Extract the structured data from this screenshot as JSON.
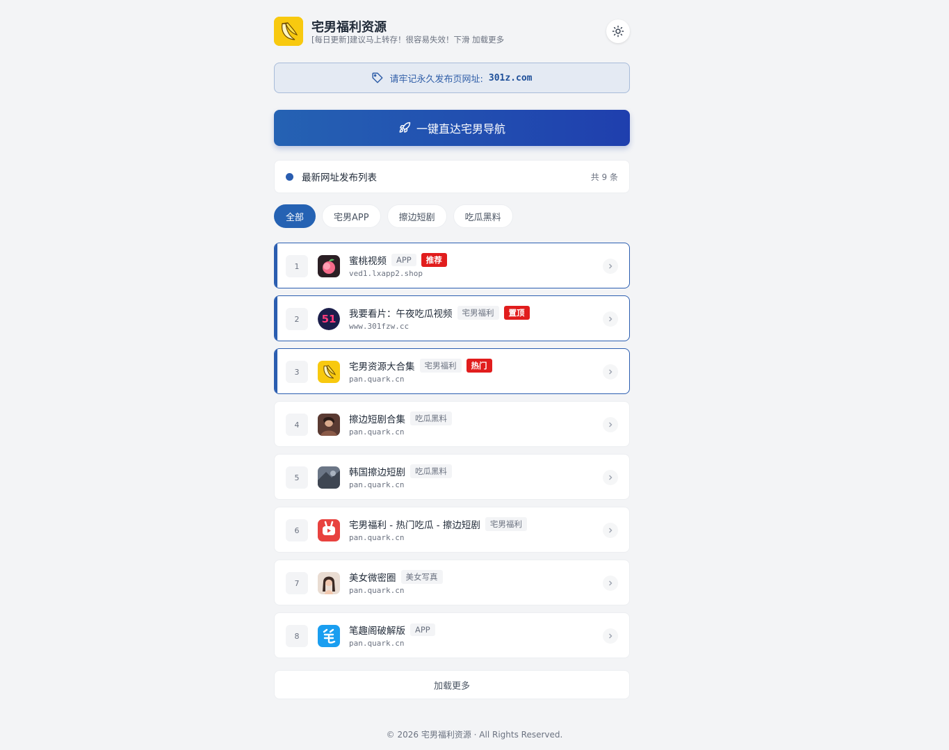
{
  "site": {
    "title": "宅男福利资源",
    "subtitle": "[每日更新]建议马上转存！很容易失效！下滑 加载更多",
    "logo_icon": "banana-icon",
    "accent": "#2562b3"
  },
  "notice": {
    "label": "请牢记永久发布页网址:",
    "domain": "301z.com"
  },
  "nav_button": {
    "label": "一键直达宅男导航"
  },
  "list_header": {
    "title": "最新网址发布列表",
    "count": "共 9 条"
  },
  "filters": [
    {
      "label": "全部",
      "active": true
    },
    {
      "label": "宅男APP",
      "active": false
    },
    {
      "label": "擦边短剧",
      "active": false
    },
    {
      "label": "吃瓜黑料",
      "active": false
    }
  ],
  "items": [
    {
      "num": "1",
      "name": "蜜桃视频",
      "tag": "APP",
      "badge": "推荐",
      "url": "ved1.lxapp2.shop",
      "icon": "peach-icon"
    },
    {
      "num": "2",
      "name": "我要看片：午夜吃瓜视频",
      "tag": "宅男福利",
      "badge": "置顶",
      "url": "www.301fzw.cc",
      "icon": "fifty-one-icon"
    },
    {
      "num": "3",
      "name": "宅男资源大合集",
      "tag": "宅男福利",
      "badge": "热门",
      "url": "pan.quark.cn",
      "icon": "banana-icon"
    },
    {
      "num": "4",
      "name": "擦边短剧合集",
      "tag": "吃瓜黑料",
      "badge": "",
      "url": "pan.quark.cn",
      "icon": "photo-thumb-icon"
    },
    {
      "num": "5",
      "name": "韩国擦边短剧",
      "tag": "吃瓜黑料",
      "badge": "",
      "url": "pan.quark.cn",
      "icon": "photo-thumb-icon"
    },
    {
      "num": "6",
      "name": "宅男福利 - 热门吃瓜 - 擦边短剧",
      "tag": "宅男福利",
      "badge": "",
      "url": "pan.quark.cn",
      "icon": "bunny-play-icon"
    },
    {
      "num": "7",
      "name": "美女微密圈",
      "tag": "美女写真",
      "badge": "",
      "url": "pan.quark.cn",
      "icon": "photo-thumb-icon"
    },
    {
      "num": "8",
      "name": "笔趣阁破解版",
      "tag": "APP",
      "badge": "",
      "url": "pan.quark.cn",
      "icon": "bi-character-icon"
    }
  ],
  "load_more": "加载更多",
  "footer": "© 2026 宅男福利资源 · All Rights Reserved."
}
